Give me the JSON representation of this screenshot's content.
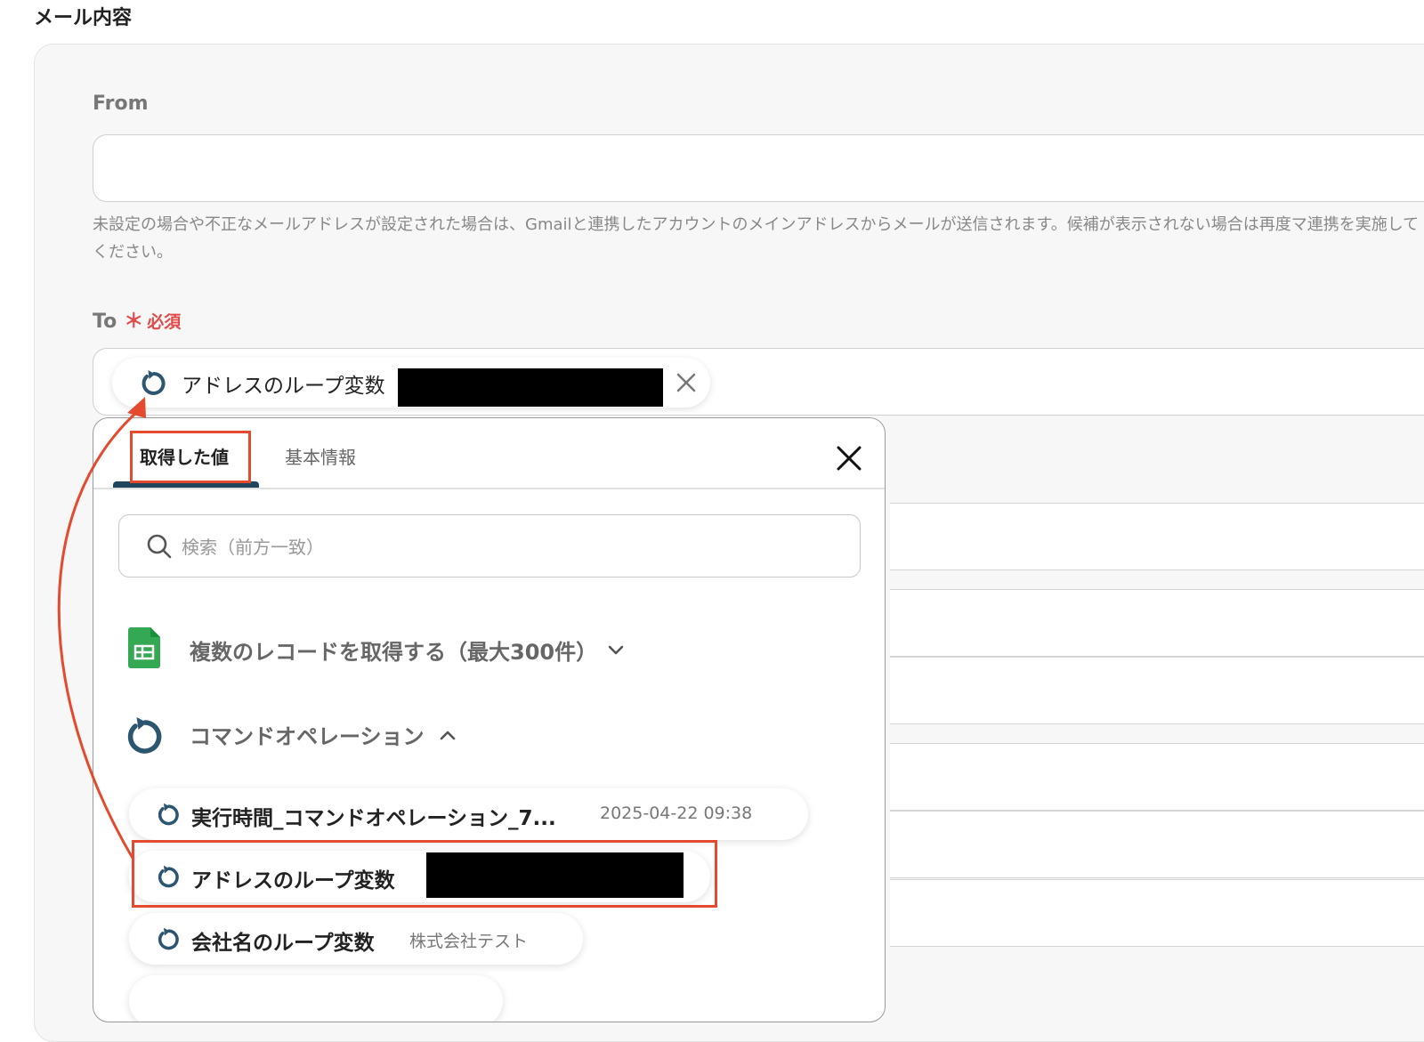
{
  "section": {
    "title": "メール内容"
  },
  "from": {
    "label": "From",
    "value": "",
    "help": "未設定の場合や不正なメールアドレスが設定された場合は、Gmailと連携したアカウントのメインアドレスからメールが送信されます。候補が表示されない場合は再度マ連携を実施してください。"
  },
  "to": {
    "label": "To",
    "required_star": "＊",
    "required_text": "必須",
    "chip": {
      "icon": "loop-icon",
      "label": "アドレスのループ変数"
    }
  },
  "popup": {
    "tabs": [
      {
        "label": "取得した値",
        "active": true
      },
      {
        "label": "基本情報",
        "active": false
      }
    ],
    "search": {
      "placeholder": "検索（前方一致）"
    },
    "groups": [
      {
        "label": "複数のレコードを取得する（最大300件）",
        "icon": "google-sheets-icon",
        "expanded": false
      },
      {
        "label": "コマンドオペレーション",
        "icon": "loop-icon",
        "expanded": true
      }
    ],
    "items": [
      {
        "label": "実行時間_コマンドオペレーション_7...",
        "value": "2025-04-22 09:38"
      },
      {
        "label": "アドレスのループ変数",
        "value": ""
      },
      {
        "label": "会社名のループ変数",
        "value": "株式会社テスト"
      }
    ]
  },
  "colors": {
    "accent": "#21455a",
    "required": "#e34b4b",
    "highlight": "#e44a2e",
    "sheets_green": "#34a853"
  }
}
